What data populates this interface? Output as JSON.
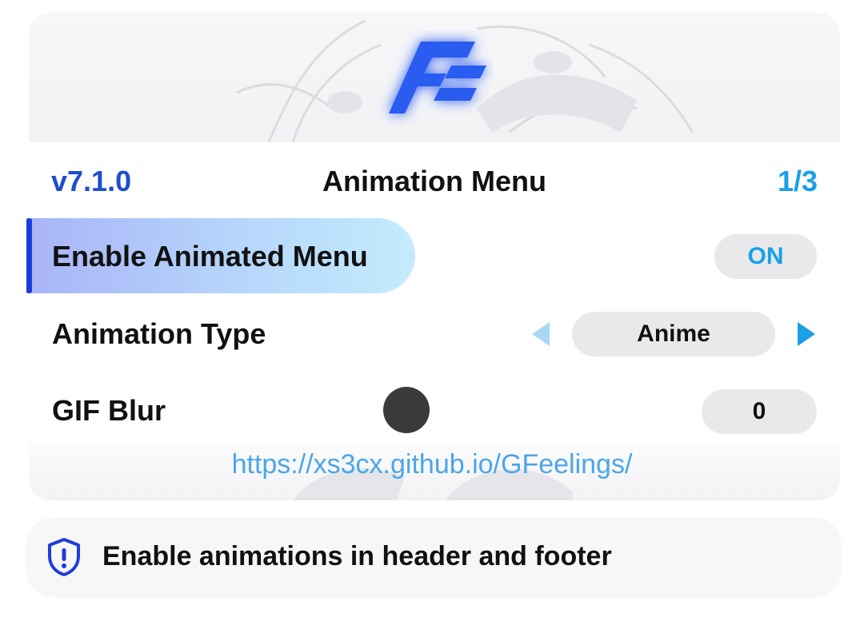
{
  "header": {
    "version": "v7.1.0",
    "title": "Animation Menu",
    "page_indicator": "1/3"
  },
  "menu": {
    "items": [
      {
        "label": "Enable Animated Menu",
        "control": "toggle",
        "value": "ON",
        "selected": true
      },
      {
        "label": "Animation Type",
        "control": "selector",
        "value": "Anime"
      },
      {
        "label": "GIF Blur",
        "control": "slider",
        "value": "0",
        "level": 0.43
      }
    ]
  },
  "footer": {
    "url": "https://xs3cx.github.io/GFeelings/"
  },
  "info": {
    "icon": "shield-exclamation-icon",
    "text": "Enable animations in header and footer"
  },
  "colors": {
    "accent_blue": "#1d4ecf",
    "cyan": "#1aa0e6",
    "selection_accent": "#1d3cdc",
    "slider_knob": "#3a3a3c",
    "url": "#4ba6ea"
  }
}
